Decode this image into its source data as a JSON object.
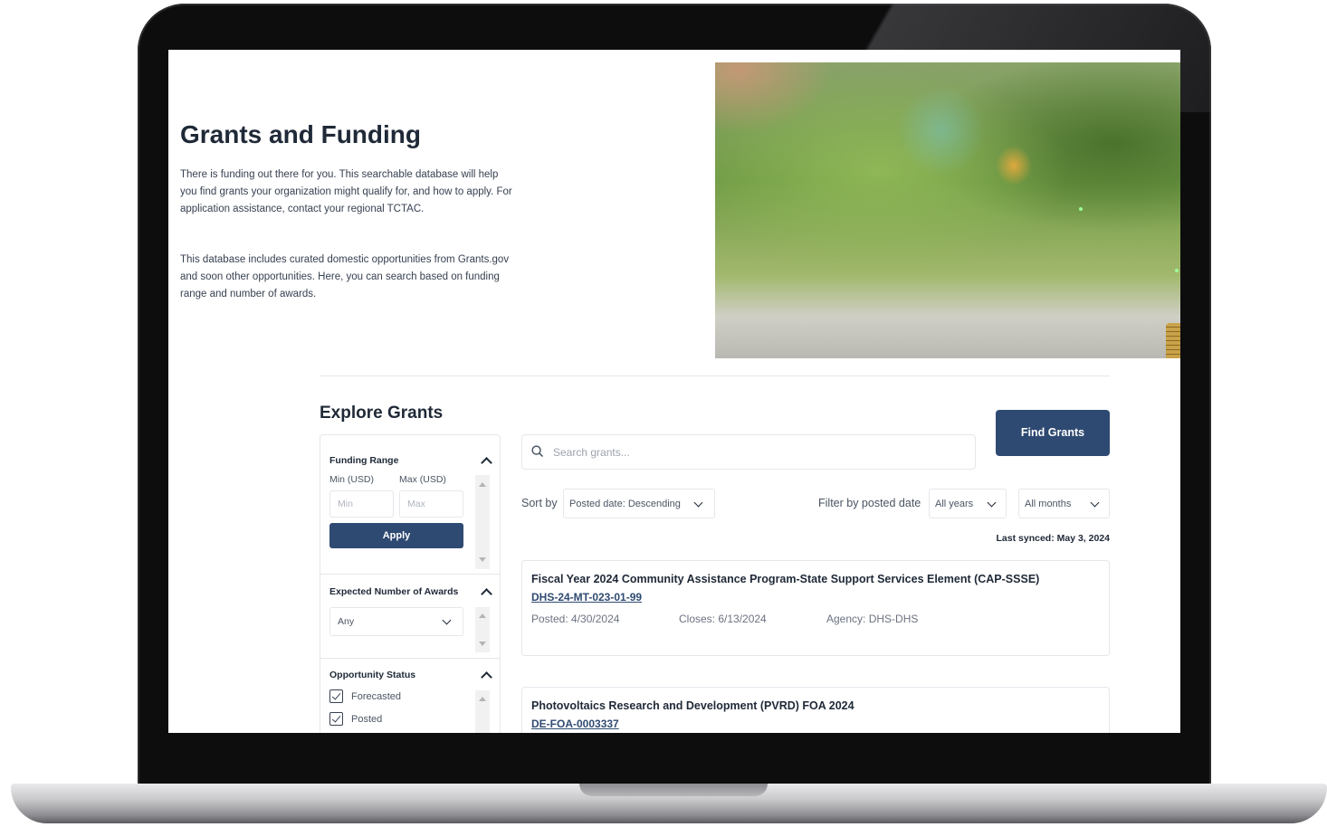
{
  "page": {
    "title": "Grants and Funding",
    "intro_p1": "There is funding out there for you. This searchable database will help you find grants your organization might qualify for, and how to apply. For application assistance, contact your regional TCTAC.",
    "intro_p2": "This database includes curated domestic opportunities from Grants.gov and soon other opportunities. Here, you can search based on funding range and number of awards.",
    "section_title": "Explore Grants"
  },
  "filters": {
    "funding_range": {
      "title": "Funding Range",
      "min_label": "Min (USD)",
      "max_label": "Max (USD)",
      "min_placeholder": "Min",
      "max_placeholder": "Max",
      "apply_label": "Apply"
    },
    "awards": {
      "title": "Expected Number of Awards",
      "selected": "Any"
    },
    "status": {
      "title": "Opportunity Status",
      "options": [
        {
          "label": "Forecasted",
          "checked": true
        },
        {
          "label": "Posted",
          "checked": true
        }
      ]
    }
  },
  "search": {
    "placeholder": "Search grants...",
    "button_label": "Find Grants"
  },
  "toolbar": {
    "sort_label": "Sort by",
    "sort_value": "Posted date: Descending",
    "filter_label": "Filter by posted date",
    "year_value": "All years",
    "month_value": "All months",
    "last_synced": "Last synced: May 3, 2024"
  },
  "grants": [
    {
      "title": "Fiscal Year 2024 Community Assistance Program-State Support Services Element (CAP-SSSE)",
      "id": "DHS-24-MT-023-01-99",
      "posted": "Posted: 4/30/2024",
      "closes": "Closes: 6/13/2024",
      "agency": "Agency: DHS-DHS"
    },
    {
      "title": "Photovoltaics Research and Development (PVRD) FOA 2024",
      "id": "DE-FOA-0003337"
    }
  ],
  "colors": {
    "primary": "#2f4a72",
    "text": "#1f2937",
    "muted": "#6b7280"
  },
  "icons": [
    "search-icon",
    "chevron-up-icon",
    "chevron-down-icon",
    "checkbox-checked-icon"
  ]
}
